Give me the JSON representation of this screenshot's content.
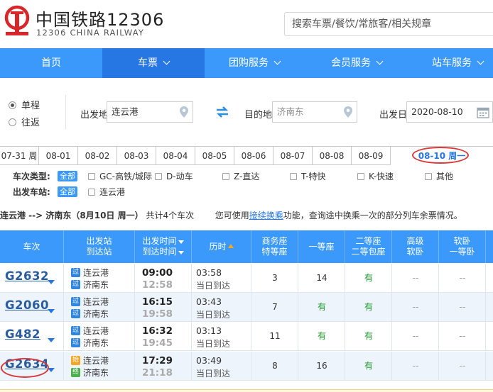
{
  "header": {
    "brand_cn": "中国铁路12306",
    "brand_en": "12306 CHINA RAILWAY",
    "search_placeholder": "搜索车票/餐饮/常旅客/相关规章"
  },
  "nav": [
    {
      "label": "首页",
      "dropdown": false,
      "active": false
    },
    {
      "label": "车票",
      "dropdown": true,
      "active": true
    },
    {
      "label": "团购服务",
      "dropdown": true,
      "active": false
    },
    {
      "label": "会员服务",
      "dropdown": true,
      "active": false
    },
    {
      "label": "站车服务",
      "dropdown": true,
      "active": false
    }
  ],
  "query": {
    "trip_one_way": "单程",
    "trip_round": "往返",
    "from_label": "出发地",
    "from_value": "连云港",
    "to_label": "目的地",
    "to_value": "济南东",
    "date_label": "出发日",
    "date_value": "2020-08-10"
  },
  "date_tabs": [
    "07-31 周",
    "08-01",
    "08-02",
    "08-03",
    "08-04",
    "08-05",
    "08-06",
    "08-07",
    "08-08",
    "08-09",
    "08-10 周一"
  ],
  "filters": {
    "train_type_title": "车次类型:",
    "all_label": "全部",
    "types": [
      "GC-高铁/城际",
      "D-动车",
      "Z-直达",
      "T-特快",
      "K-快速",
      "其他"
    ],
    "depart_station_title": "出发车站:",
    "stations": [
      "连云港"
    ]
  },
  "info": {
    "route": "连云港 --> 济南东（8月10日 周一）",
    "count_text": "共计4个车次",
    "hint_pre": "您可使用",
    "hint_link": "接续换乘",
    "hint_post": "功能，查询途中换乘一次的部分列车余票情况。"
  },
  "table": {
    "headers": {
      "train": "车次",
      "station_1": "出发站",
      "station_2": "到达站",
      "time_1": "出发时间",
      "time_2": "到达时间",
      "duration": "历时",
      "business_1": "商务座",
      "business_2": "特等座",
      "first": "一等座",
      "second_1": "二等座",
      "second_2": "二等包座",
      "soft_sleeper_1": "高级",
      "soft_sleeper_2": "软卧",
      "soft1_1": "软卧",
      "soft1_2": "一等卧"
    },
    "rows": [
      {
        "no": "G2632",
        "dep_badge": "过",
        "dep": "连云港",
        "arr_badge": "过",
        "arr": "济南东",
        "dep_time": "09:00",
        "arr_time": "12:58",
        "duration": "03:58",
        "note": "当日到达",
        "business": "3",
        "first": "14",
        "second": "有",
        "adv_soft": "--",
        "soft1": "--"
      },
      {
        "no": "G2060",
        "dep_badge": "过",
        "dep": "连云港",
        "arr_badge": "过",
        "arr": "济南东",
        "dep_time": "16:15",
        "arr_time": "19:58",
        "duration": "03:43",
        "note": "当日到达",
        "business": "7",
        "first": "有",
        "second": "有",
        "adv_soft": "--",
        "soft1": "--"
      },
      {
        "no": "G482",
        "dep_badge": "过",
        "dep": "连云港",
        "arr_badge": "过",
        "arr": "济南东",
        "dep_time": "16:32",
        "arr_time": "19:45",
        "duration": "03:13",
        "note": "当日到达",
        "business": "11",
        "first": "有",
        "second": "有",
        "adv_soft": "--",
        "soft1": "--"
      },
      {
        "no": "G2634",
        "dep_badge": "始",
        "dep": "连云港",
        "arr_badge": "终",
        "arr": "济南东",
        "dep_time": "17:29",
        "arr_time": "21:18",
        "duration": "03:49",
        "note": "当日到达",
        "business": "8",
        "first": "16",
        "second": "有",
        "adv_soft": "--",
        "soft1": "--"
      }
    ]
  },
  "colors": {
    "primary": "#3b99fc",
    "nav_active": "#2676e3",
    "available": "#1e9b2e",
    "highlight_circle": "#d9383a"
  }
}
